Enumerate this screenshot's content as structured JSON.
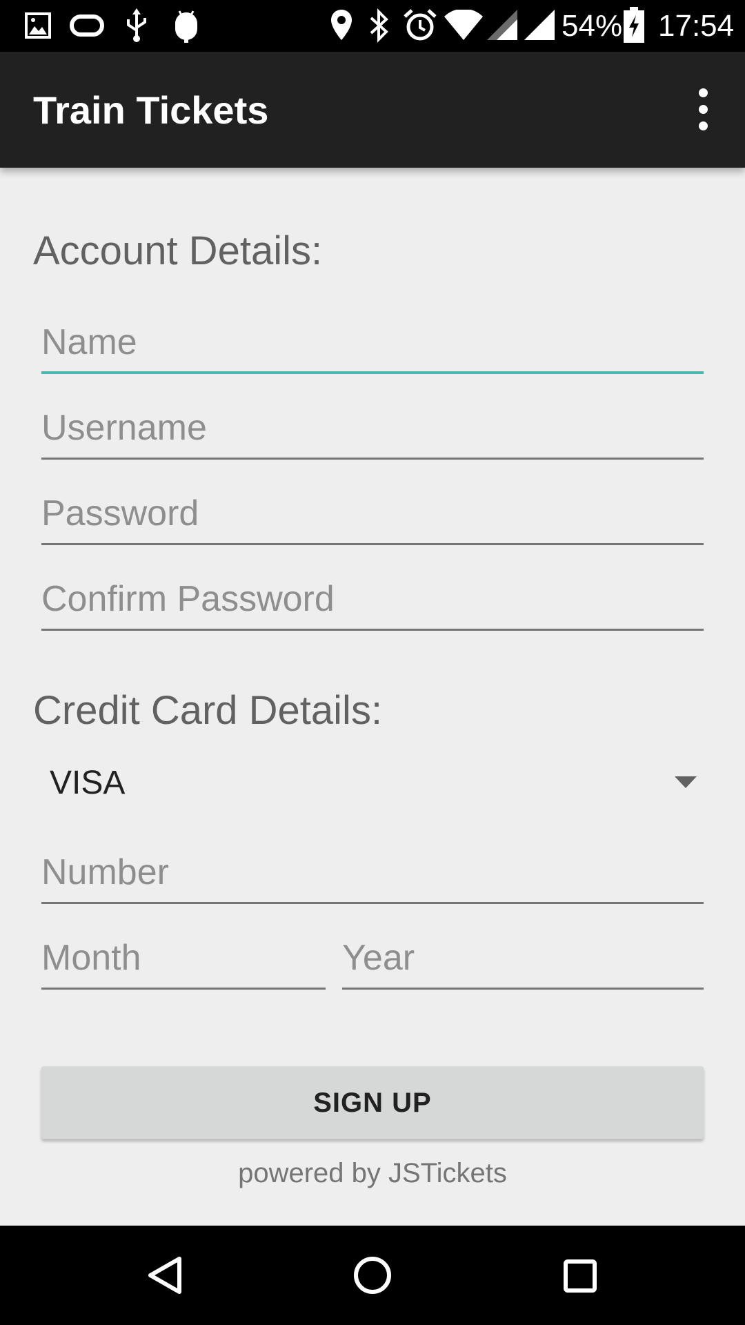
{
  "status_bar": {
    "battery": "54%",
    "time": "17:54",
    "icons": [
      "image-icon",
      "loop-icon",
      "usb-icon",
      "android-icon",
      "location-icon",
      "bluetooth-icon",
      "alarm-icon",
      "wifi-icon",
      "signal-icon",
      "battery-charging-icon"
    ]
  },
  "app_bar": {
    "title": "Train Tickets",
    "menu_icon": "overflow-menu-icon"
  },
  "account": {
    "header": "Account Details:",
    "name_placeholder": "Name",
    "username_placeholder": "Username",
    "password_placeholder": "Password",
    "confirm_password_placeholder": "Confirm Password"
  },
  "credit_card": {
    "header": "Credit Card Details:",
    "card_type_selected": "VISA",
    "number_placeholder": "Number",
    "month_placeholder": "Month",
    "year_placeholder": "Year"
  },
  "actions": {
    "signup_label": "SIGN UP"
  },
  "footer": {
    "powered_by": "powered by JSTickets"
  },
  "nav_bar": {
    "icons": [
      "back-icon",
      "home-icon",
      "recents-icon"
    ]
  },
  "colors": {
    "accent": "#4db6ac",
    "app_bar": "#212121",
    "background": "#eeeeee",
    "button": "#d6d7d7"
  }
}
